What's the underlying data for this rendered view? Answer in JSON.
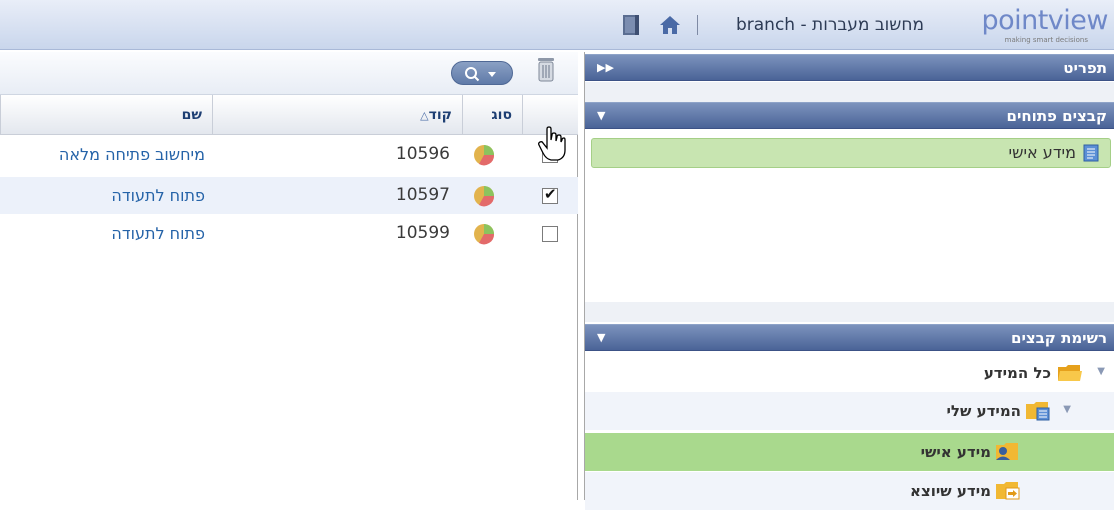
{
  "header": {
    "logo_text": "pointview",
    "logo_tagline": "making smart decisions",
    "app_title": "מחשוב מעברות - branch"
  },
  "right": {
    "menu_panel_title": "תפריט",
    "open_files_panel_title": "קבצים פתוחים",
    "open_files": [
      {
        "label": "מידע אישי"
      }
    ],
    "file_list_panel_title": "רשימת קבצים",
    "tree": [
      {
        "label": "כל המידע"
      },
      {
        "label": "המידע שלי"
      },
      {
        "label": "מידע אישי"
      },
      {
        "label": "מידע שיוצא"
      }
    ]
  },
  "grid": {
    "columns": {
      "name": "שם",
      "code": "קוד",
      "type": "סוג"
    },
    "rows": [
      {
        "name": "מיחשוב פתיחה מלאה",
        "code": "10596",
        "checked": false
      },
      {
        "name": "פתוח לתעודה",
        "code": "10597",
        "checked": true
      },
      {
        "name": "פתוח לתעודה",
        "code": "10599",
        "checked": false
      }
    ],
    "checkmark": "✔"
  },
  "colors": {
    "panel_bar": "#5a73a6",
    "highlight_green": "#c8e5b1",
    "link_blue": "#2563a8"
  }
}
